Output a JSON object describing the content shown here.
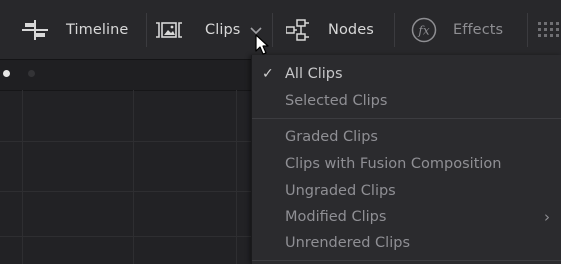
{
  "toolbar": {
    "timeline_label": "Timeline",
    "clips_label": "Clips",
    "nodes_label": "Nodes",
    "effects_label": "Effects",
    "icons": {
      "timeline": "timeline-icon",
      "clips": "clips-icon",
      "clips_dropdown": "chevron-down-icon",
      "nodes": "nodes-icon",
      "effects": "fx-icon",
      "grid": "grid-icon"
    }
  },
  "clips_menu": {
    "selected": "All Clips",
    "group1": [
      {
        "label": "All Clips",
        "checked": true
      },
      {
        "label": "Selected Clips",
        "checked": false
      }
    ],
    "group2": [
      {
        "label": "Graded Clips"
      },
      {
        "label": "Clips with Fusion Composition"
      },
      {
        "label": "Ungraded Clips"
      },
      {
        "label": "Modified Clips",
        "submenu": true
      },
      {
        "label": "Unrendered Clips"
      }
    ],
    "check_mark": "✓",
    "submenu_arrow": "›"
  },
  "colors": {
    "toolbar_bg": "#28282b",
    "menu_bg": "#2b2b2e",
    "text": "#d8d8d8",
    "text_dim": "#8f8f94"
  }
}
